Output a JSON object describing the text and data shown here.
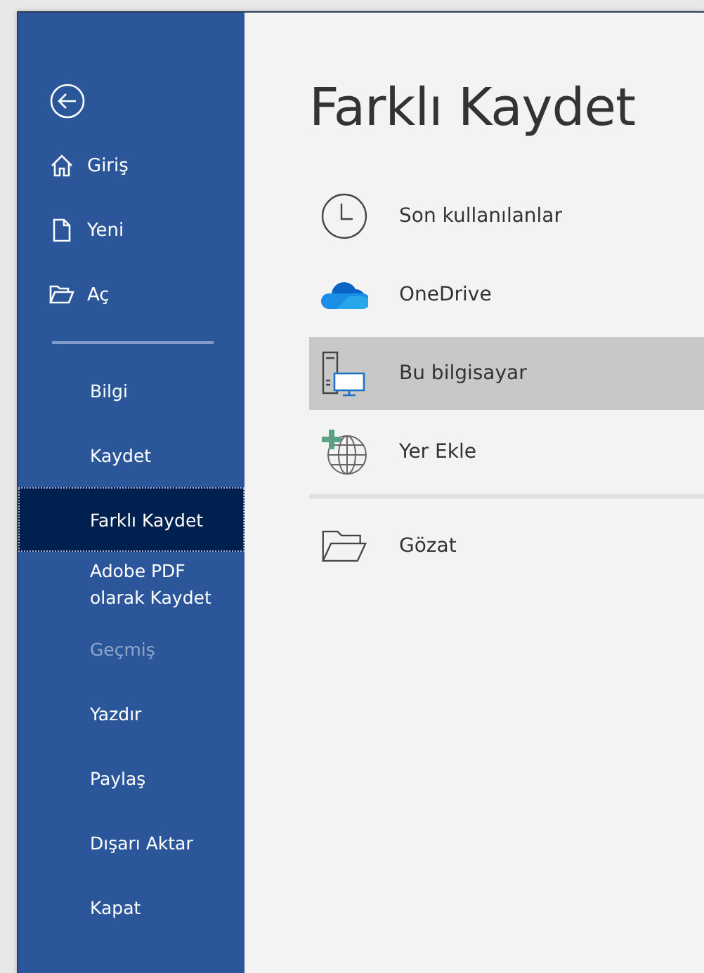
{
  "sidebar": {
    "nav_items": [
      {
        "kind": "back",
        "selected": false
      },
      {
        "kind": "home",
        "label": "Giriş",
        "selected": false
      },
      {
        "kind": "new",
        "label": "Yeni",
        "selected": false
      },
      {
        "kind": "open",
        "label": "Aç",
        "selected": false
      }
    ],
    "items": [
      {
        "label": "Bilgi",
        "selected": false,
        "disabled": false
      },
      {
        "label": "Kaydet",
        "selected": false,
        "disabled": false
      },
      {
        "label": "Farklı Kaydet",
        "selected": true,
        "disabled": false
      },
      {
        "label": "Adobe PDF olarak Kaydet",
        "selected": false,
        "disabled": false
      },
      {
        "label": "Geçmiş",
        "selected": false,
        "disabled": true
      },
      {
        "label": "Yazdır",
        "selected": false,
        "disabled": false
      },
      {
        "label": "Paylaş",
        "selected": false,
        "disabled": false
      },
      {
        "label": "Dışarı Aktar",
        "selected": false,
        "disabled": false
      },
      {
        "label": "Kapat",
        "selected": false,
        "disabled": false
      }
    ]
  },
  "main": {
    "title": "Farklı Kaydet",
    "locations": [
      {
        "kind": "recent",
        "label": "Son kullanılanlar",
        "selected": false
      },
      {
        "kind": "onedrive",
        "label": "OneDrive",
        "selected": false
      },
      {
        "kind": "computer",
        "label": "Bu bilgisayar",
        "selected": true
      },
      {
        "kind": "add_place",
        "label": "Yer Ekle",
        "selected": false
      }
    ],
    "other_locations": [
      {
        "kind": "browse",
        "label": "Gözat",
        "selected": false
      }
    ]
  }
}
